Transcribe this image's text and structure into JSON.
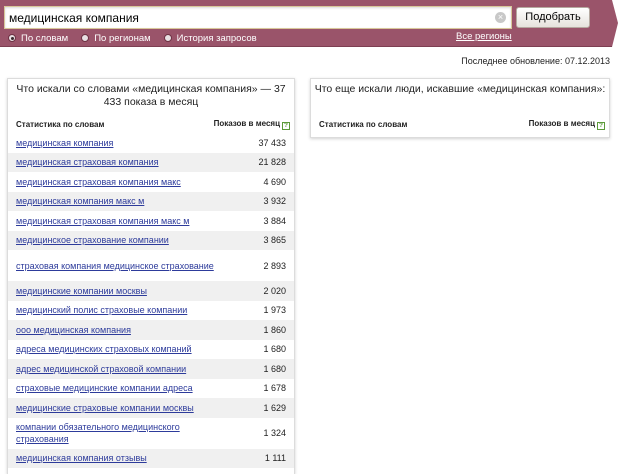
{
  "search": {
    "query": "медицинская компания",
    "button_label": "Подобрать",
    "clear_icon": "clear-icon"
  },
  "modes": [
    {
      "label": "По словам",
      "selected": true
    },
    {
      "label": "По регионам",
      "selected": false
    },
    {
      "label": "История запросов",
      "selected": false
    }
  ],
  "regions_link": "Все регионы",
  "last_update": "Последнее обновление: 07.12.2013",
  "left_panel": {
    "title": "Что искали со словами «медицинская компания» — 37 433 показа в месяц",
    "col_keywords": "Статистика по словам",
    "col_count": "Показов в месяц",
    "help_icon_label": "?",
    "rows": [
      {
        "keyword": "медицинская компания",
        "count": "37 433"
      },
      {
        "keyword": "медицинская страховая компания",
        "count": "21 828"
      },
      {
        "keyword": "медицинская страховая компания макс",
        "count": "4 690"
      },
      {
        "keyword": "медицинская компания макс м",
        "count": "3 932"
      },
      {
        "keyword": "медицинская страховая компания макс м",
        "count": "3 884"
      },
      {
        "keyword": "медицинское страхование компании",
        "count": "3 865"
      },
      {
        "keyword": "страховая компания медицинское страхование",
        "count": "2 893",
        "tall": true
      },
      {
        "keyword": "медицинские компании москвы",
        "count": "2 020"
      },
      {
        "keyword": "медицинский полис страховые компании",
        "count": "1 973"
      },
      {
        "keyword": "ооо медицинская компания",
        "count": "1 860"
      },
      {
        "keyword": "адреса медицинских страховых компаний",
        "count": "1 680"
      },
      {
        "keyword": "адрес медицинской страховой компании",
        "count": "1 680"
      },
      {
        "keyword": "страховые медицинские компании адреса",
        "count": "1 678"
      },
      {
        "keyword": "медицинские страховые компании москвы",
        "count": "1 629"
      },
      {
        "keyword": "компании обязательного медицинского страхования",
        "count": "1 324",
        "tall": true
      },
      {
        "keyword": "медицинская компания отзывы",
        "count": "1 111"
      }
    ]
  },
  "right_panel": {
    "title": "Что еще искали люди, искавшие «медицинская компания»:",
    "col_keywords": "Статистика по словам",
    "col_count": "Показов в месяц",
    "help_icon_label": "?"
  }
}
